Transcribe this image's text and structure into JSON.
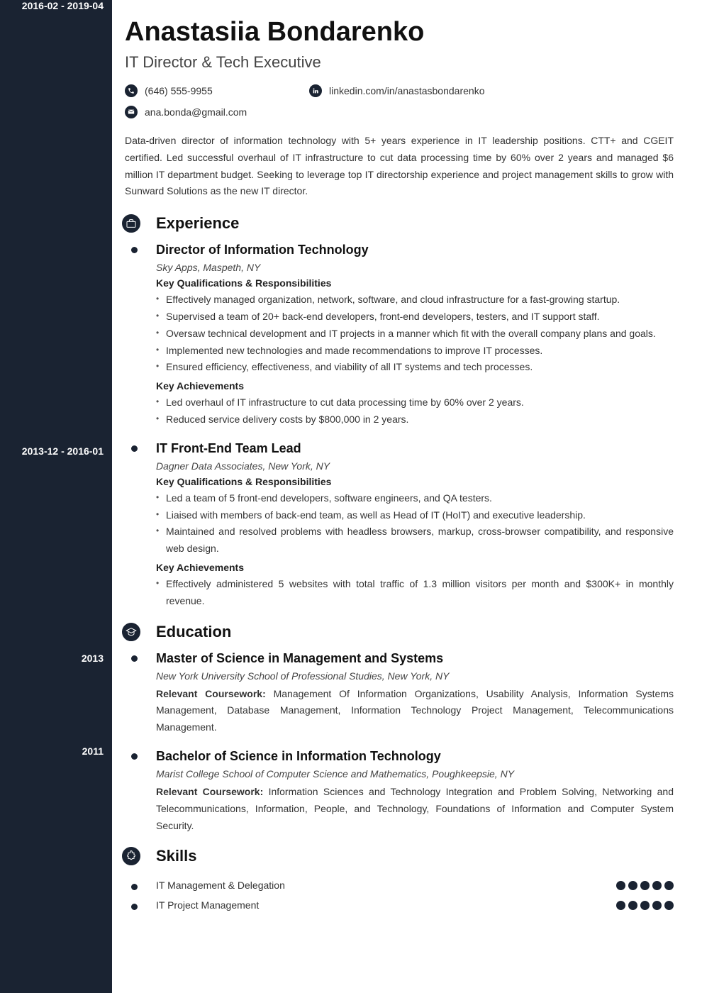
{
  "name": "Anastasiia Bondarenko",
  "subtitle": "IT Director & Tech Executive",
  "contacts": {
    "phone": "(646) 555-9955",
    "linkedin": "linkedin.com/in/anastasbondarenko",
    "email": "ana.bonda@gmail.com"
  },
  "summary": "Data-driven director of information technology with 5+ years experience in IT leadership positions. CTT+ and CGEIT certified. Led successful overhaul of IT infrastructure to cut data processing time by 60% over 2 years and managed $6 million IT department budget. Seeking to leverage top IT directorship experience and project management skills to grow with Sunward Solutions as the new IT director.",
  "sections": {
    "experience": {
      "title": "Experience",
      "entries": [
        {
          "date": "2016-02 - 2019-04",
          "title": "Director of Information Technology",
          "sub": "Sky Apps, Maspeth, NY",
          "heading1": "Key Qualifications & Responsibilities",
          "bullets1": [
            "Effectively managed organization, network, software, and cloud infrastructure for a fast-growing startup.",
            "Supervised a team of 20+ back-end developers, front-end developers, testers, and IT support staff.",
            "Oversaw technical development and IT projects in a manner which fit with the overall company plans and goals.",
            "Implemented new technologies and made recommendations to improve IT processes.",
            "Ensured efficiency, effectiveness, and viability of all IT systems and tech processes."
          ],
          "heading2": "Key Achievements",
          "bullets2": [
            "Led overhaul of IT infrastructure to cut data processing time by 60% over 2 years.",
            "Reduced service delivery costs by $800,000 in 2 years."
          ]
        },
        {
          "date": "2013-12 - 2016-01",
          "title": "IT Front-End Team Lead",
          "sub": "Dagner Data Associates, New York, NY",
          "heading1": "Key Qualifications & Responsibilities",
          "bullets1": [
            "Led a team of 5 front-end developers, software engineers, and QA testers.",
            "Liaised with members of back-end team, as well as Head of IT (HoIT) and executive leadership.",
            "Maintained and resolved problems with headless browsers, markup, cross-browser compatibility, and responsive web design."
          ],
          "heading2": "Key Achievements",
          "bullets2": [
            "Effectively administered 5 websites with total traffic of 1.3 million visitors per month and $300K+ in monthly revenue."
          ]
        }
      ]
    },
    "education": {
      "title": "Education",
      "entries": [
        {
          "date": "2013",
          "title": "Master of Science in Management and Systems",
          "sub": "New York University School of Professional Studies, New York, NY",
          "label": "Relevant Coursework:",
          "text": " Management Of Information Organizations, Usability Analysis, Information Systems Management, Database Management, Information Technology Project Management, Telecommunications Management."
        },
        {
          "date": "2011",
          "title": "Bachelor of Science in Information Technology",
          "sub": "Marist College School of Computer Science and Mathematics, Poughkeepsie, NY",
          "label": "Relevant Coursework:",
          "text": " Information Sciences and Technology Integration and Problem Solving, Networking and Telecommunications, Information, People, and Technology, Foundations of Information and Computer System Security."
        }
      ]
    },
    "skills": {
      "title": "Skills",
      "items": [
        {
          "name": "IT Management & Delegation",
          "rating": 5
        },
        {
          "name": "IT Project Management",
          "rating": 5
        }
      ]
    }
  },
  "dateOffsets": {
    "exp0": "333px",
    "exp1": "628px",
    "edu0": "920px",
    "edu1": "1051px"
  }
}
